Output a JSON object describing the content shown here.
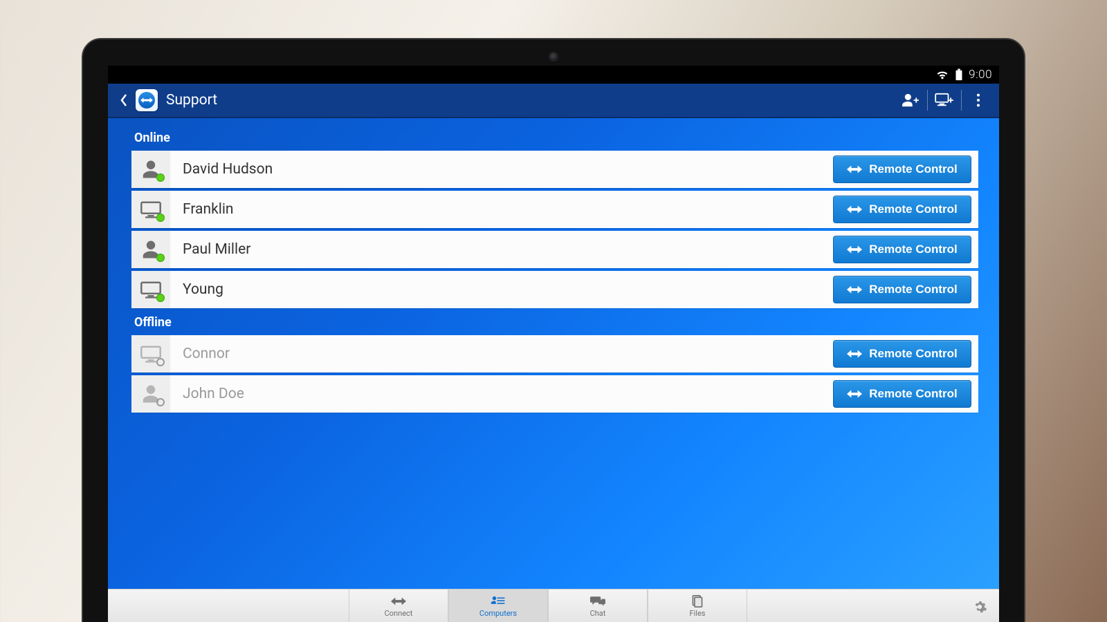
{
  "status": {
    "time": "9:00"
  },
  "header": {
    "title": "Support"
  },
  "sections": {
    "online": {
      "label": "Online",
      "items": [
        {
          "name": "David Hudson",
          "type": "person"
        },
        {
          "name": "Franklin",
          "type": "computer"
        },
        {
          "name": "Paul Miller",
          "type": "person"
        },
        {
          "name": "Young",
          "type": "computer"
        }
      ]
    },
    "offline": {
      "label": "Offline",
      "items": [
        {
          "name": "Connor",
          "type": "computer"
        },
        {
          "name": "John Doe",
          "type": "person"
        }
      ]
    }
  },
  "buttons": {
    "remote_control": "Remote Control"
  },
  "tabs": [
    {
      "id": "connect",
      "label": "Connect"
    },
    {
      "id": "computers",
      "label": "Computers"
    },
    {
      "id": "chat",
      "label": "Chat"
    },
    {
      "id": "files",
      "label": "Files"
    }
  ]
}
